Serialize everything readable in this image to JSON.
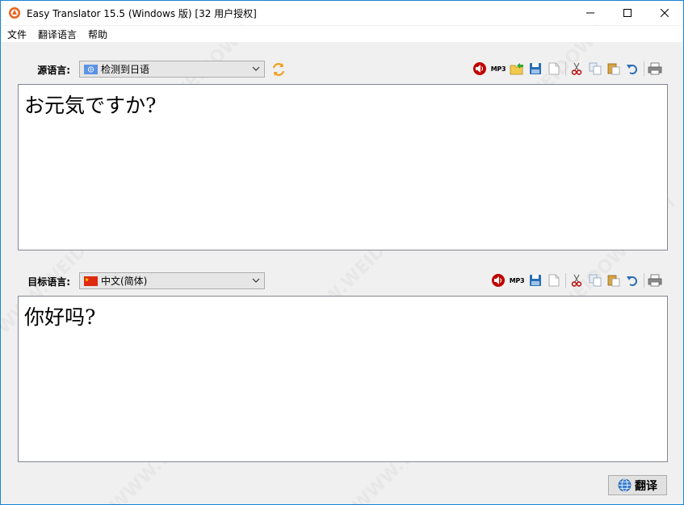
{
  "window": {
    "title": "Easy Translator 15.5 (Windows 版) [32 用户授权]"
  },
  "menu": {
    "items": [
      "文件",
      "翻译语言",
      "帮助"
    ]
  },
  "source": {
    "label": "源语言:",
    "selected_language": "检测到日语",
    "flag_icon": "un-flag-icon",
    "text": "お元気ですか?"
  },
  "target": {
    "label": "目标语言:",
    "selected_language": "中文(简体)",
    "flag_icon": "china-flag-icon",
    "text": "你好吗?"
  },
  "toolbar": {
    "mp3_label": "MP3"
  },
  "translate_button": {
    "label": "翻译"
  },
  "watermark_text": "WWW.WEIDOWN.COM",
  "colors": {
    "accent": "#1883d7",
    "speaker": "#c00000"
  }
}
